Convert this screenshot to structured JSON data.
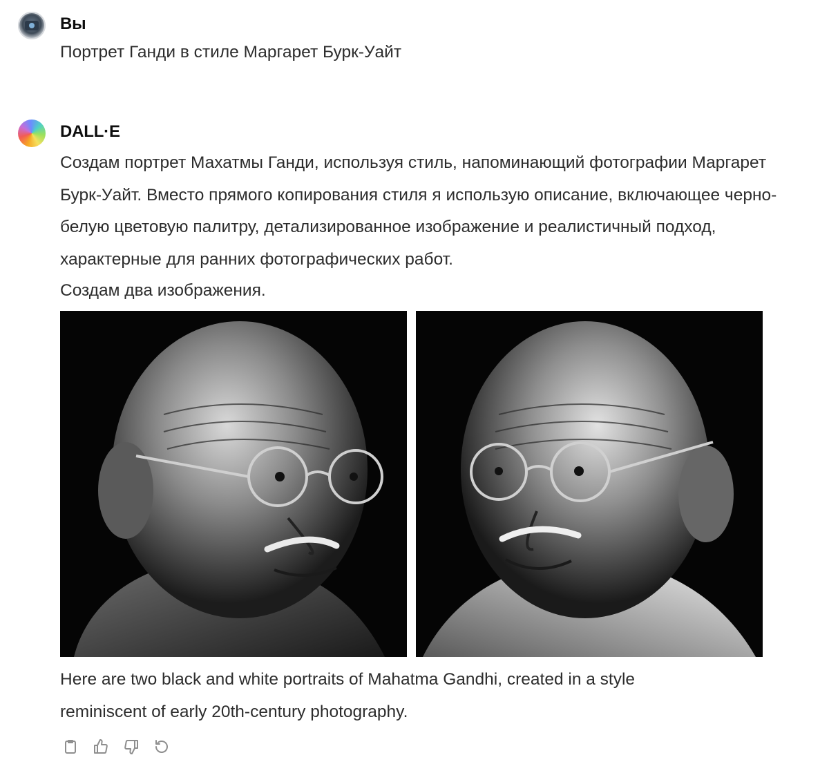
{
  "user_message": {
    "author": "Вы",
    "text": "Портрет Ганди в стиле Маргарет Бурк-Уайт",
    "avatar_icon": "camera-avatar-icon"
  },
  "assistant_message": {
    "author": "DALL·E",
    "avatar_icon": "dalle-logo-icon",
    "intro_paragraph": "Создам портрет Махатмы Ганди, используя стиль, напоминающий фотографии Маргарет Бурк-Уайт. Вместо прямого копирования стиля я использую описание, включающее черно-белую цветовую палитру, детализированное изображение и реалистичный подход, характерные для ранних фотографических работ.",
    "intro_line_last": "Создам два изображения.",
    "images": [
      {
        "subject": "black-and-white portrait, head turned right"
      },
      {
        "subject": "black-and-white portrait, head turned left"
      }
    ],
    "caption": "Here are two black and white portraits of Mahatma Gandhi, created in a style reminiscent of early 20th-century photography.",
    "actions": [
      "copy-icon",
      "thumbs-up-icon",
      "thumbs-down-icon",
      "regenerate-icon"
    ]
  },
  "colors": {
    "text_primary": "#0d0d0d",
    "text_body": "#2d2d2d",
    "icon_gray": "#8e8e8e",
    "image_background": "#050505"
  }
}
